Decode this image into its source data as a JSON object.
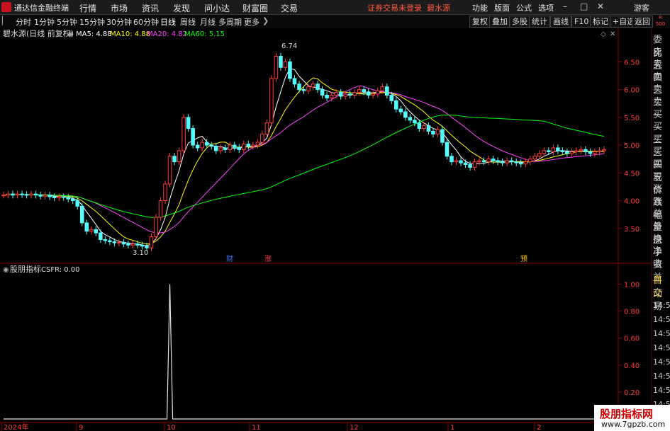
{
  "app": {
    "title": "通达信金融终端",
    "warning": "证券交易未登录",
    "stock_name": "碧水源"
  },
  "menu": [
    "行情",
    "市场",
    "资讯",
    "发现",
    "问小达",
    "财富圈",
    "交易"
  ],
  "right_menu": [
    "功能",
    "版面",
    "公式",
    "选项"
  ],
  "guest_label": "游客",
  "periods": [
    "分时",
    "1分钟",
    "5分钟",
    "15分钟",
    "30分钟",
    "60分钟",
    "日线",
    "周线",
    "月线",
    "多周期",
    "更多"
  ],
  "active_period": "日线",
  "toolbar_buttons": [
    "复权",
    "叠加",
    "多股",
    "统计",
    "画线",
    "F10",
    "标记",
    "+自选",
    "返回"
  ],
  "r_badge": {
    "line1": "R",
    "line2": "500"
  },
  "main_panel": {
    "title": "碧水源(日线 前复权)",
    "ma": [
      {
        "label": "MA5: 4.88",
        "color": "#ffffff"
      },
      {
        "label": "MA10: 4.88",
        "color": "#ffff00"
      },
      {
        "label": "MA20: 4.82",
        "color": "#ff40ff"
      },
      {
        "label": "MA60: 5.15",
        "color": "#00ff00"
      }
    ],
    "high_label": "6.74",
    "low_label": "3.10",
    "y_ticks": [
      "6.50",
      "6.00",
      "5.50",
      "5.00",
      "4.50",
      "4.00",
      "3.50"
    ],
    "event_marks": [
      "财",
      "涨",
      "预"
    ]
  },
  "sub_panel": {
    "title": "股朋指标",
    "value": "CSFR: 0.00",
    "y_ticks": [
      "1.00",
      "0.80",
      "0.60",
      "0.40",
      "0.20"
    ]
  },
  "x_axis": [
    "2024年",
    "9",
    "10",
    "11",
    "12",
    "1",
    "2"
  ],
  "sidebar": {
    "quote_labels": [
      "委比",
      "卖五",
      "卖四",
      "卖三",
      "卖二",
      "卖一",
      "买一",
      "买二",
      "买三",
      "买四",
      "买五",
      "现价",
      "涨跌",
      "涨幅",
      "总量",
      "外盘",
      "换手",
      "净资",
      "收益"
    ],
    "lower_labels": [
      "自动",
      "交易"
    ],
    "times": [
      "14:56",
      "14:56",
      "14:56",
      "14:56",
      "14:56",
      "14:56",
      "14:56",
      "14:56"
    ]
  },
  "watermark": {
    "line1": "股朋指标网",
    "line2": "www.7gpzb.com"
  },
  "chart_data": [
    {
      "type": "candlestick",
      "title": "碧水源(日线 前复权)",
      "ylim": [
        3.0,
        6.9
      ],
      "x_labels": [
        "2024年",
        "9",
        "10",
        "11",
        "12",
        "1",
        "2"
      ],
      "series": [
        {
          "name": "MA5",
          "last": 4.88
        },
        {
          "name": "MA10",
          "last": 4.88
        },
        {
          "name": "MA20",
          "last": 4.82
        },
        {
          "name": "MA60",
          "last": 5.15
        }
      ],
      "annotations": [
        {
          "text": "6.74",
          "value": 6.74
        },
        {
          "text": "3.10",
          "value": 3.1
        }
      ],
      "closes": [
        4.1,
        4.12,
        4.1,
        4.12,
        4.11,
        4.1,
        4.12,
        4.1,
        4.08,
        4.1,
        4.07,
        4.05,
        4.07,
        4.06,
        4.03,
        4.0,
        3.9,
        3.6,
        3.45,
        3.48,
        3.42,
        3.3,
        3.28,
        3.26,
        3.24,
        3.25,
        3.22,
        3.2,
        3.22,
        3.2,
        3.18,
        3.15,
        3.35,
        3.7,
        4.0,
        4.3,
        4.8,
        4.7,
        4.9,
        5.5,
        5.3,
        5.0,
        4.95,
        5.05,
        5.0,
        4.98,
        4.9,
        4.95,
        4.92,
        5.0,
        4.96,
        4.92,
        5.02,
        4.98,
        5.0,
        5.05,
        5.2,
        5.4,
        6.2,
        6.6,
        6.4,
        6.5,
        6.2,
        6.1,
        6.0,
        5.98,
        6.05,
        6.1,
        6.0,
        5.9,
        5.85,
        5.9,
        5.95,
        5.88,
        5.92,
        5.9,
        5.95,
        6.0,
        5.96,
        5.9,
        5.92,
        5.98,
        6.05,
        5.9,
        5.8,
        5.65,
        5.6,
        5.5,
        5.45,
        5.4,
        5.3,
        5.35,
        5.25,
        5.2,
        5.28,
        5.05,
        4.8,
        4.7,
        4.72,
        4.68,
        4.65,
        4.6,
        4.7,
        4.72,
        4.7,
        4.75,
        4.72,
        4.7,
        4.68,
        4.72,
        4.7,
        4.68,
        4.66,
        4.7,
        4.75,
        4.8,
        4.85,
        4.9,
        4.88,
        4.95,
        4.9,
        4.88,
        4.85,
        4.88,
        4.9,
        4.92,
        4.88,
        4.85,
        4.88,
        4.9,
        4.92
      ]
    },
    {
      "type": "line",
      "title": "股朋指标",
      "ylim": [
        0,
        1.05
      ],
      "series": [
        {
          "name": "CSFR",
          "last": 0.0
        }
      ],
      "spike": {
        "value": 1.0
      }
    }
  ]
}
